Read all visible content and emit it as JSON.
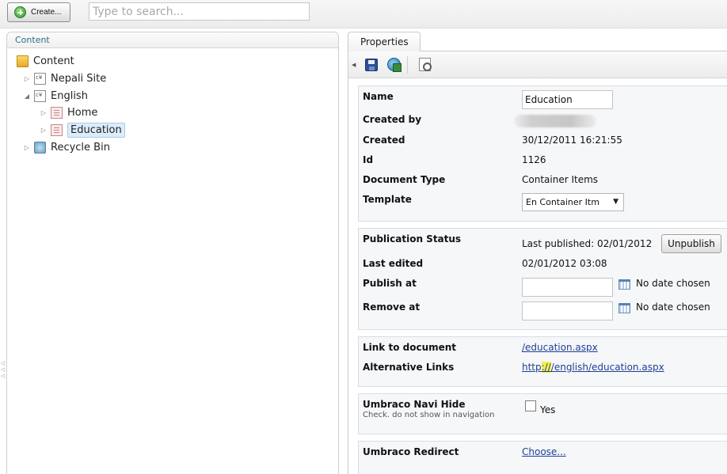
{
  "toolbar": {
    "create_label": "Create...",
    "search_placeholder": "Type to search..."
  },
  "tree": {
    "header": "Content",
    "items": [
      {
        "label": "Content",
        "icon": "folder-icon",
        "expanded": true
      },
      {
        "label": "Nepali Site",
        "icon": "document-type-icon",
        "expanded": false
      },
      {
        "label": "English",
        "icon": "document-type-icon",
        "expanded": true
      },
      {
        "label": "Home",
        "icon": "page-icon",
        "expanded": false
      },
      {
        "label": "Education",
        "icon": "page-icon",
        "expanded": false,
        "selected": true
      },
      {
        "label": "Recycle Bin",
        "icon": "recycle-bin-icon",
        "expanded": false
      }
    ]
  },
  "properties": {
    "tab_label": "Properties",
    "toolbar_icons": [
      "save-icon",
      "save-and-publish-icon",
      "preview-icon"
    ],
    "general": {
      "name_label": "Name",
      "name_value": "Education",
      "created_by_label": "Created by",
      "created_label": "Created",
      "created_value": "30/12/2011 16:21:55",
      "id_label": "Id",
      "id_value": "1126",
      "doctype_label": "Document Type",
      "doctype_value": "Container Items",
      "template_label": "Template",
      "template_value": "En Container Itm"
    },
    "publication": {
      "status_label": "Publication Status",
      "status_value": "Last published: 02/01/2012",
      "unpublish_label": "Unpublish",
      "last_edited_label": "Last edited",
      "last_edited_value": "02/01/2012 03:08",
      "publish_at_label": "Publish at",
      "publish_at_date": "No date chosen",
      "remove_at_label": "Remove at",
      "remove_at_date": "No date chosen"
    },
    "links": {
      "link_label": "Link to document",
      "link_value": "/education.aspx",
      "alt_label": "Alternative Links",
      "alt_prefix": "http",
      "alt_highlight": "://",
      "alt_suffix": "/english/education.aspx"
    },
    "navi_hide": {
      "label": "Umbraco Navi Hide",
      "description": "Check. do not show in navigation",
      "checkbox_label": "Yes",
      "checked": false
    },
    "redirect": {
      "label": "Umbraco Redirect",
      "choose_label": "Choose..."
    }
  },
  "colors": {
    "link": "#1f3f95",
    "highlight": "#f6f146",
    "selected_bg": "#dcecfb",
    "section_bg": "#f6f7f9",
    "header_text": "#2a6f8a"
  }
}
